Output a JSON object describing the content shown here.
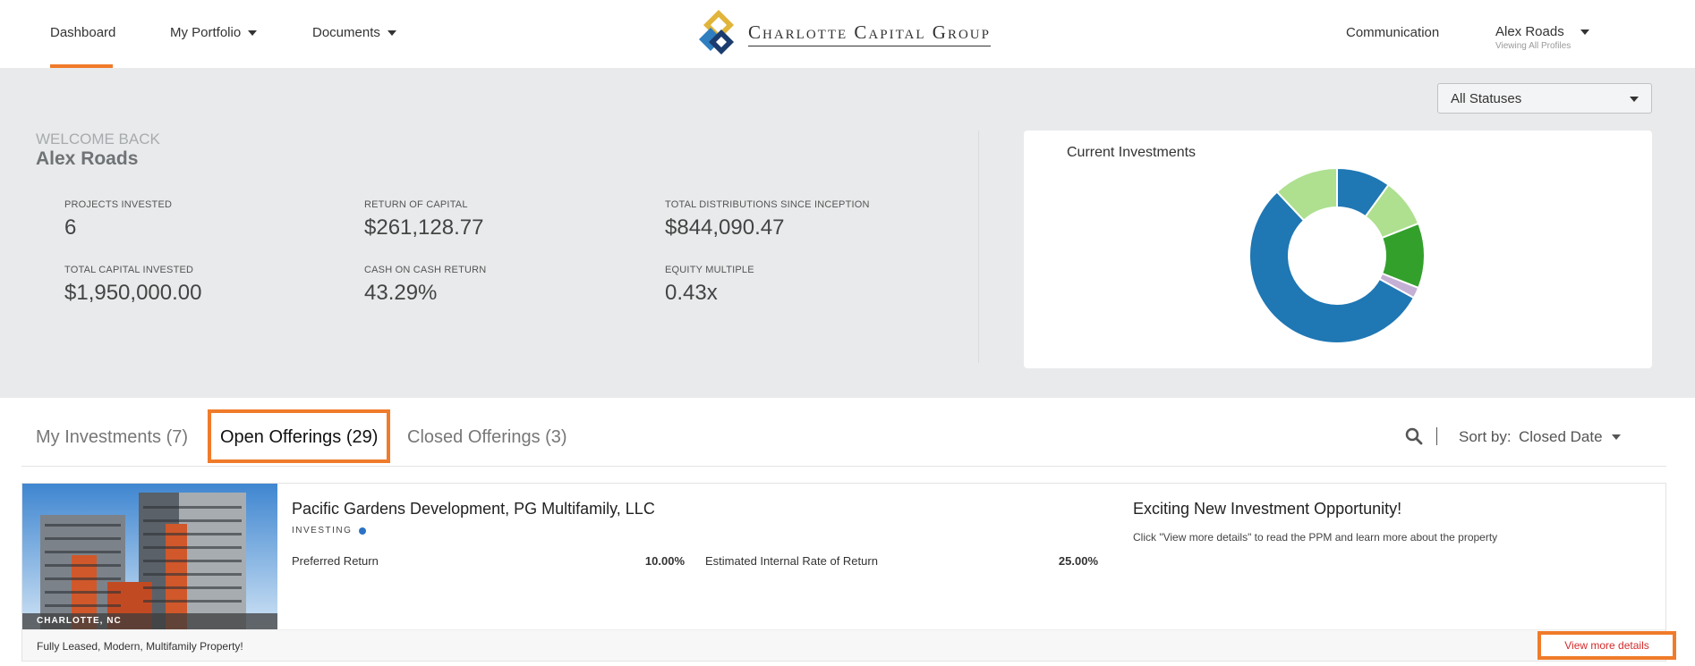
{
  "nav": {
    "dashboard": "Dashboard",
    "portfolio": "My Portfolio",
    "documents": "Documents",
    "communication": "Communication",
    "logo_text": "Charlotte Capital Group",
    "user_name": "Alex Roads",
    "user_sub": "Viewing All Profiles"
  },
  "hero": {
    "status_select": "All Statuses",
    "welcome": "WELCOME BACK",
    "name": "Alex Roads",
    "stats": {
      "projects_invested": {
        "label": "PROJECTS INVESTED",
        "value": "6"
      },
      "return_of_capital": {
        "label": "RETURN OF CAPITAL",
        "value": "$261,128.77"
      },
      "total_distributions": {
        "label": "TOTAL DISTRIBUTIONS SINCE INCEPTION",
        "value": "$844,090.47"
      },
      "total_capital": {
        "label": "TOTAL CAPITAL INVESTED",
        "value": "$1,950,000.00"
      },
      "cash_on_cash": {
        "label": "CASH ON CASH RETURN",
        "value": "43.29%"
      },
      "equity_multiple": {
        "label": "EQUITY MULTIPLE",
        "value": "0.43x"
      }
    },
    "chart_title": "Current Investments"
  },
  "chart_data": {
    "type": "pie",
    "title": "Current Investments",
    "values": [
      10,
      9,
      12,
      2,
      55,
      12
    ],
    "colors": [
      "#1f77b4",
      "#aee08f",
      "#33a02c",
      "#c5b0d5",
      "#1f77b4",
      "#aee08f"
    ]
  },
  "tabs": {
    "my_investments": "My Investments (7)",
    "open_offerings": "Open Offerings (29)",
    "closed_offerings": "Closed Offerings (3)",
    "sort_label": "Sort by:",
    "sort_value": "Closed Date"
  },
  "offering": {
    "image_label": "CHARLOTTE, NC",
    "title": "Pacific Gardens Development, PG Multifamily, LLC",
    "status": "INVESTING",
    "preferred_return_label": "Preferred Return",
    "preferred_return_value": "10.00%",
    "irr_label": "Estimated Internal Rate of Return",
    "irr_value": "25.00%",
    "promo_title": "Exciting New Investment Opportunity!",
    "promo_text": "Click \"View more details\" to read the PPM and learn more about the property",
    "footer_text": "Fully Leased, Modern, Multifamily Property!",
    "details_button": "View more details"
  }
}
